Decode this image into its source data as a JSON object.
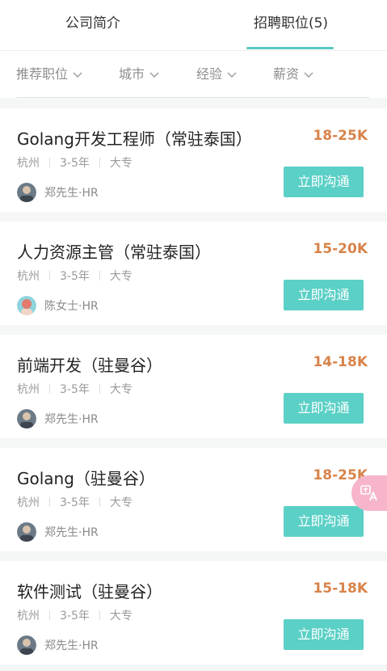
{
  "tabs": {
    "company_intro": "公司简介",
    "jobs": "招聘职位(5)"
  },
  "filters": {
    "recommended": "推荐职位",
    "city": "城市",
    "experience": "经验",
    "salary": "薪资"
  },
  "colors": {
    "accent": "#5bd0c6",
    "salary": "#d8834a"
  },
  "jobs": [
    {
      "title": "Golang开发工程师（常驻泰国）",
      "salary": "18-25K",
      "city": "杭州",
      "experience": "3-5年",
      "education": "大专",
      "hr": "郑先生·HR",
      "button": "立即沟通"
    },
    {
      "title": "人力资源主管（常驻泰国）",
      "salary": "15-20K",
      "city": "杭州",
      "experience": "3-5年",
      "education": "大专",
      "hr": "陈女士·HR",
      "button": "立即沟通"
    },
    {
      "title": "前端开发（驻曼谷）",
      "salary": "14-18K",
      "city": "杭州",
      "experience": "3-5年",
      "education": "大专",
      "hr": "郑先生·HR",
      "button": "立即沟通"
    },
    {
      "title": "Golang（驻曼谷）",
      "salary": "18-25K",
      "city": "杭州",
      "experience": "3-5年",
      "education": "大专",
      "hr": "郑先生·HR",
      "button": "立即沟通"
    },
    {
      "title": "软件测试（驻曼谷）",
      "salary": "15-18K",
      "city": "杭州",
      "experience": "3-5年",
      "education": "大专",
      "hr": "郑先生·HR",
      "button": "立即沟通"
    }
  ],
  "translate_icon": "translate-icon"
}
